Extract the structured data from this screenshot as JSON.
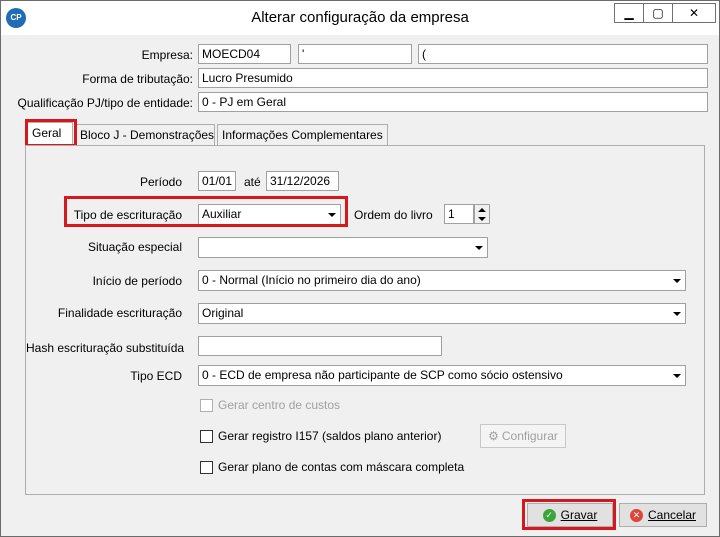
{
  "window": {
    "title": "Alterar configuração da empresa",
    "icon": "CP",
    "controls": {
      "minimize": "▁",
      "maximize": "▢",
      "close": "✕"
    }
  },
  "header": {
    "empresa_label": "Empresa:",
    "empresa_code": "MOECD04",
    "empresa_field2": "'",
    "empresa_field3": "(",
    "tributacao_label": "Forma de tributação:",
    "tributacao_value": "Lucro Presumido",
    "qualificacao_label": "Qualificação PJ/tipo de entidade:",
    "qualificacao_value": "0 - PJ em Geral"
  },
  "tabs": [
    {
      "label": "Geral"
    },
    {
      "label": "Bloco J - Demonstrações"
    },
    {
      "label": "Informações Complementares"
    }
  ],
  "geral": {
    "periodo_label": "Período",
    "periodo_inicio": "01/01",
    "ate_label": "até",
    "periodo_fim": "31/12/2026",
    "tipo_escrit_label": "Tipo de escrituração",
    "tipo_escrit_value": "Auxiliar",
    "ordem_label": "Ordem do livro",
    "ordem_value": "1",
    "situacao_label": "Situação especial",
    "situacao_value": "",
    "inicio_label": "Início de período",
    "inicio_value": "0 - Normal (Início no primeiro dia do ano)",
    "finalidade_label": "Finalidade escrituração",
    "finalidade_value": "Original",
    "hash_label": "Hash escrituração substituída",
    "hash_value": "",
    "tipo_ecd_label": "Tipo ECD",
    "tipo_ecd_value": "0 - ECD de empresa não participante de SCP como sócio ostensivo",
    "chk_centro_label": "Gerar centro de custos",
    "chk_i157_label": "Gerar registro I157 (saldos plano anterior)",
    "configurar_label": "Configurar",
    "chk_mascara_label": "Gerar plano de contas com máscara completa"
  },
  "footer": {
    "gravar_label": "Gravar",
    "cancelar_label": "Cancelar"
  },
  "colors": {
    "highlight": "#d6181e",
    "ok_icon": "#3aa53a",
    "cancel_icon": "#e0453a"
  }
}
